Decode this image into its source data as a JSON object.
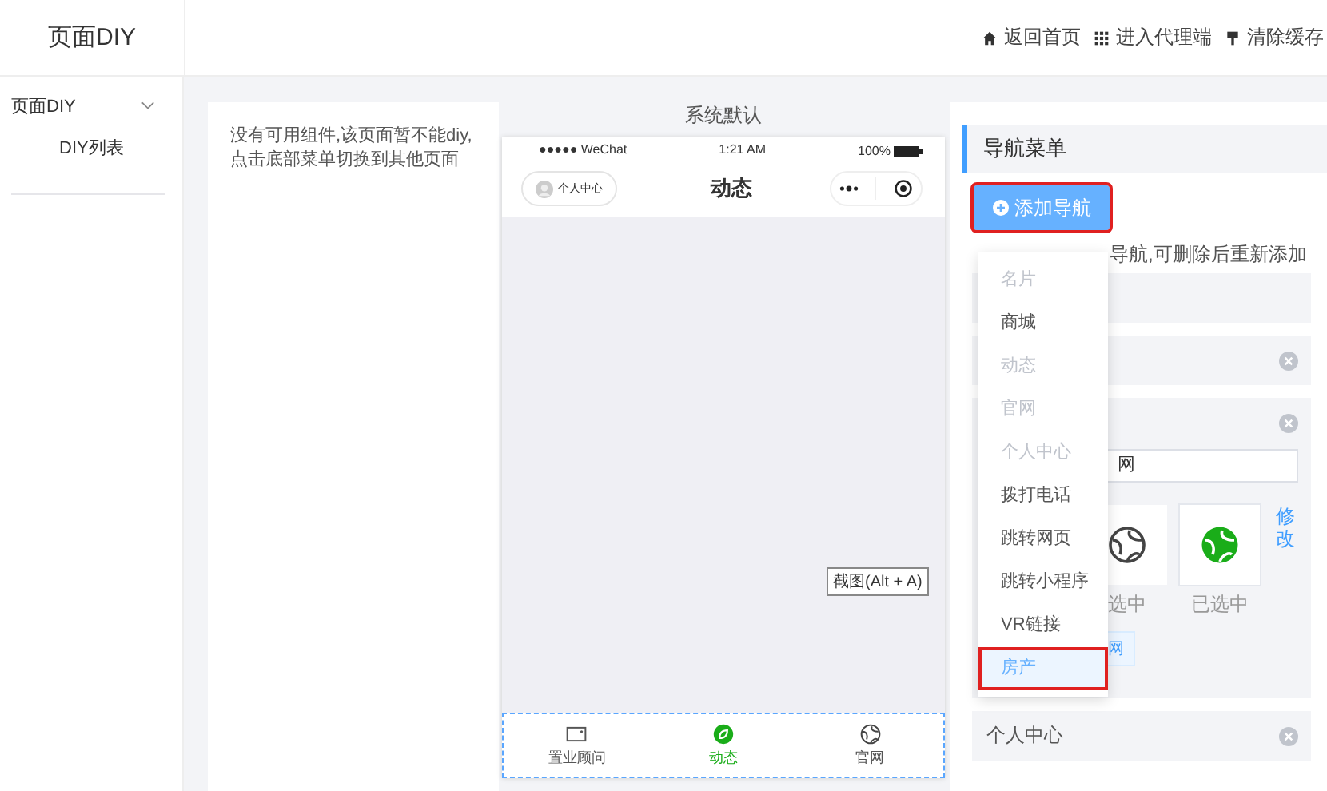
{
  "header": {
    "title": "页面DIY",
    "links": [
      {
        "label": "返回首页"
      },
      {
        "label": "进入代理端"
      },
      {
        "label": "清除缓存"
      }
    ]
  },
  "sidebar": {
    "groups": [
      {
        "label": "页面DIY",
        "expanded": true,
        "children": [
          {
            "label": "DIY列表"
          }
        ]
      }
    ]
  },
  "notice": "没有可用组件,该页面暂不能diy,点击底部菜单切换到其他页面",
  "preview": {
    "title": "系统默认",
    "status": {
      "carrier": "●●●●● WeChat",
      "time": "1:21 AM",
      "battery": "100%"
    },
    "nav": {
      "profile": "个人中心",
      "title": "动态"
    },
    "tabs": [
      {
        "label": "置业顾问",
        "selected": false
      },
      {
        "label": "动态",
        "selected": true
      },
      {
        "label": "官网",
        "selected": false
      }
    ]
  },
  "tooltip": "截图(Alt + A)",
  "panel": {
    "title": "导航菜单",
    "add_button": {
      "label": "添加导航",
      "annotated": true
    },
    "hint": "导航,可删除后重新添加",
    "cards": [
      {
        "kind": "blank"
      },
      {
        "kind": "closable"
      },
      {
        "kind": "editor",
        "name_value": "网",
        "icons": [
          {
            "label": "选中",
            "selected": false
          },
          {
            "label": "已选中",
            "selected": true
          }
        ],
        "edit_link": "修改",
        "tag": "网"
      },
      {
        "kind": "closable",
        "label": "个人中心"
      }
    ]
  },
  "dropdown": {
    "items": [
      {
        "label": "名片",
        "disabled": true,
        "selected": false
      },
      {
        "label": "商城",
        "disabled": false,
        "selected": false
      },
      {
        "label": "动态",
        "disabled": true,
        "selected": false
      },
      {
        "label": "官网",
        "disabled": true,
        "selected": false
      },
      {
        "label": "个人中心",
        "disabled": true,
        "selected": false
      },
      {
        "label": "拨打电话",
        "disabled": false,
        "selected": false
      },
      {
        "label": "跳转网页",
        "disabled": false,
        "selected": false
      },
      {
        "label": "跳转小程序",
        "disabled": false,
        "selected": false
      },
      {
        "label": "VR链接",
        "disabled": false,
        "selected": false
      },
      {
        "label": "房产",
        "disabled": false,
        "selected": true,
        "annotated": true
      }
    ]
  }
}
